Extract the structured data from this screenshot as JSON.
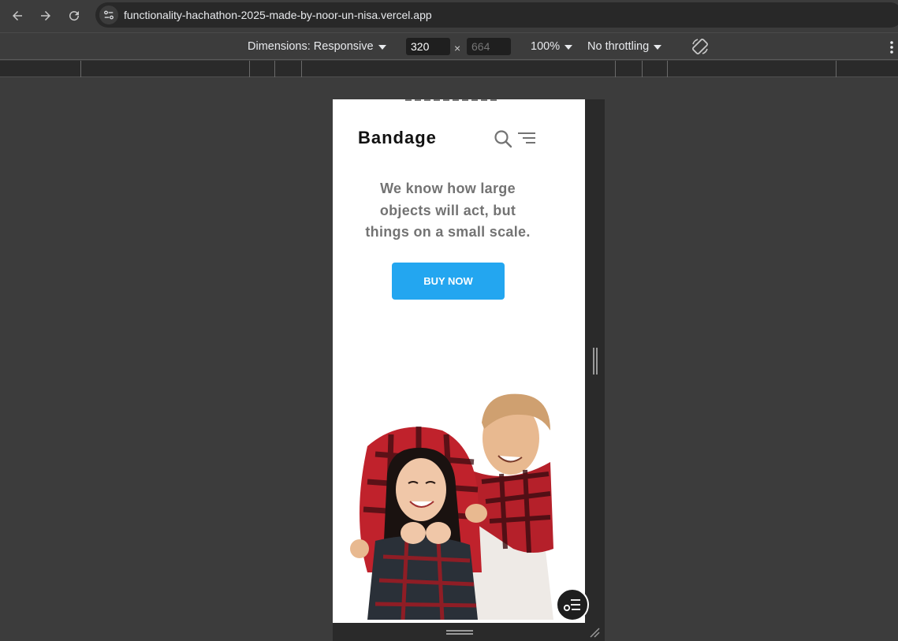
{
  "browser": {
    "url": "functionality-hachathon-2025-made-by-noor-un-nisa.vercel.app"
  },
  "devtools": {
    "dimensions_label": "Dimensions: Responsive",
    "width_value": "320",
    "height_placeholder": "664",
    "times_sign": "×",
    "zoom_label": "100%",
    "throttling_label": "No throttling"
  },
  "page": {
    "brand": "Bandage",
    "headline": "We know how large objects will act, but things on a small scale.",
    "cta_label": "BUY NOW",
    "hero_image": "couple-in-red-plaid-scarves"
  },
  "colors": {
    "cta": "#23a6f0",
    "brand_text": "#111111",
    "headline_text": "#737373"
  }
}
